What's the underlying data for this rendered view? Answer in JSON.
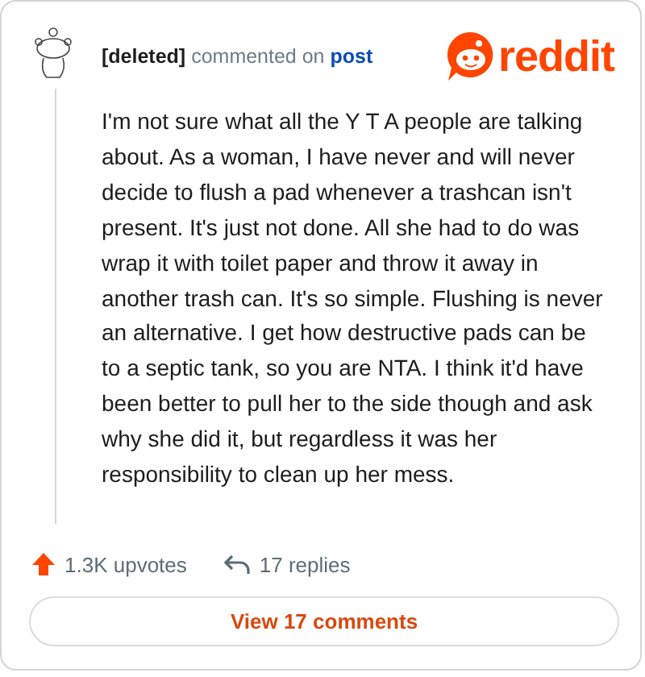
{
  "header": {
    "author": "[deleted]",
    "action": "commented on",
    "target": "post"
  },
  "logo": {
    "wordmark": "reddit"
  },
  "comment": {
    "body": "I'm not sure what all the Y T A people are talking about. As a woman, I have never and will never decide to flush a pad whenever a trashcan isn't present. It's just not done. All she had to do was wrap it with toilet paper and throw it away in another trash can. It's so simple. Flushing is never an alternative. I get how destructive pads can be to a septic tank, so you are NTA. I think it'd have been better to pull her to the side though and ask why she did it, but regardless it was her responsibility to clean up her mess."
  },
  "stats": {
    "upvotes": "1.3K upvotes",
    "replies": "17 replies"
  },
  "button": {
    "label": "View 17 comments"
  }
}
